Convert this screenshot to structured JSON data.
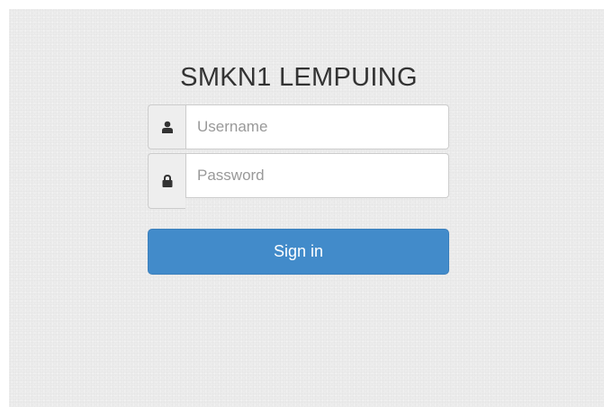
{
  "login": {
    "title": "SMKN1 LEMPUING",
    "username": {
      "placeholder": "Username",
      "value": "",
      "icon": "user-icon"
    },
    "password": {
      "placeholder": "Password",
      "value": "",
      "icon": "lock-icon"
    },
    "submit_label": "Sign in"
  },
  "colors": {
    "background": "#ececec",
    "accent": "#428bca",
    "title_text": "#333333",
    "icon": "#333333"
  }
}
